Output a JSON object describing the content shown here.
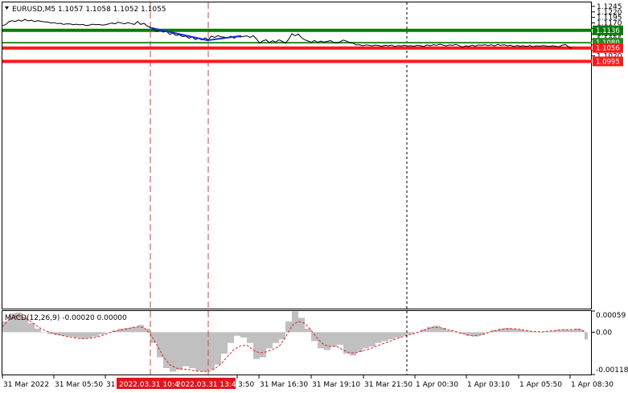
{
  "chart_data": {
    "type": "line",
    "symbol": "EURUSD,M5",
    "ohlc": {
      "open": "1.1057",
      "high": "1.1058",
      "low": "1.1052",
      "close": "1.1055"
    },
    "header_text": "EURUSD,M5  1.1057 1.1058 1.1052 1.1055",
    "price_axis": {
      "ylim": [
        0.9872,
        1.1263
      ],
      "ticks": [
        "1.1245",
        "1.1220",
        "1.1195",
        "1.1170",
        "1.1145",
        "1.1120",
        "1.1095",
        "1.1070",
        "1.1045",
        "1.1020"
      ]
    },
    "time_labels": [
      "31 Mar 2022",
      "31 Mar 05:50",
      "31",
      "3:50",
      "31 Mar 16:30",
      "31 Mar 19:10",
      "31 Mar 21:50",
      "1 Apr 00:30",
      "1 Apr 03:10",
      "1 Apr 05:50",
      "1 Apr 08:30"
    ],
    "highlighted_time_labels": [
      "2022.03.31 10:4",
      "2022.03.31 13:40"
    ],
    "levels": [
      {
        "value": 1.1136,
        "label": "1.1136",
        "color": "#0b7a0b",
        "style": "thick"
      },
      {
        "value": 1.108,
        "label": "1.1080",
        "color": "#1f8f1f",
        "style": "thin"
      },
      {
        "value": 1.1056,
        "label": "1.1056",
        "color": "#ff1a1a",
        "style": "thick"
      },
      {
        "value": 1.0995,
        "label": "1.0995",
        "color": "#ff1a1a",
        "style": "thick"
      }
    ],
    "price_series": {
      "name": "EURUSD",
      "color": "#000000",
      "x": [
        0,
        4,
        8,
        12,
        16,
        20,
        24,
        28,
        32,
        36,
        40,
        44,
        48,
        52,
        56,
        60,
        64,
        68,
        72,
        76,
        80,
        84,
        88,
        92,
        96,
        100,
        104,
        108,
        112,
        116,
        120,
        124,
        128,
        132,
        136,
        140,
        144,
        148,
        152,
        156,
        160,
        164,
        168,
        172,
        176,
        180,
        184,
        188,
        192,
        196,
        200,
        204,
        208,
        212,
        216,
        220,
        224,
        228,
        232,
        236,
        240,
        244,
        248,
        252,
        256,
        260,
        264,
        268,
        272,
        276,
        280,
        284,
        288,
        292,
        296,
        300,
        304,
        308,
        312,
        316,
        320,
        324,
        328,
        332,
        336,
        340,
        344,
        348,
        352,
        356,
        360,
        364,
        368,
        372,
        376,
        380,
        384,
        388,
        392,
        396,
        400,
        404,
        408,
        412,
        416,
        420,
        424,
        428,
        432,
        436,
        440,
        444,
        448,
        452,
        456,
        460,
        464,
        468,
        472,
        476,
        480,
        484,
        488,
        492,
        496,
        500,
        504,
        508,
        512,
        516,
        520,
        524,
        528,
        532,
        536,
        540,
        544,
        548,
        552,
        556,
        560,
        564,
        568,
        572,
        576,
        580,
        584,
        588,
        592,
        596,
        600,
        604,
        608,
        612,
        616,
        620,
        624,
        628,
        632,
        636,
        640,
        644,
        648,
        652,
        656,
        660,
        664,
        668,
        672,
        676,
        680,
        684,
        688,
        692,
        696,
        700,
        704,
        708,
        712,
        716,
        720,
        724
      ],
      "y": [
        1.1158,
        1.1162,
        1.1175,
        1.118,
        1.1176,
        1.1183,
        1.1178,
        1.1186,
        1.1179,
        1.1182,
        1.1176,
        1.118,
        1.1177,
        1.1175,
        1.1174,
        1.117,
        1.1171,
        1.1167,
        1.1168,
        1.1163,
        1.1166,
        1.1165,
        1.1162,
        1.1164,
        1.1161,
        1.1163,
        1.1158,
        1.116,
        1.1164,
        1.1162,
        1.1163,
        1.116,
        1.1162,
        1.1165,
        1.1169,
        1.1166,
        1.1173,
        1.1169,
        1.1166,
        1.1171,
        1.1167,
        1.1163,
        1.1176,
        1.1163,
        1.1168,
        1.1156,
        1.115,
        1.114,
        1.113,
        1.1138,
        1.1128,
        1.1132,
        1.1118,
        1.1123,
        1.1113,
        1.1116,
        1.1108,
        1.111,
        1.11,
        1.1106,
        1.1094,
        1.11,
        1.1092,
        1.1102,
        1.1094,
        1.111,
        1.1104,
        1.1112,
        1.1107,
        1.1105,
        1.1102,
        1.111,
        1.11,
        1.1108,
        1.1106,
        1.1109,
        1.1111,
        1.1104,
        1.1112,
        1.1097,
        1.1078,
        1.1089,
        1.1093,
        1.1081,
        1.1089,
        1.1083,
        1.1093,
        1.1086,
        1.1078,
        1.1095,
        1.1121,
        1.1112,
        1.1119,
        1.1103,
        1.1093,
        1.1088,
        1.1082,
        1.109,
        1.1082,
        1.1087,
        1.1083,
        1.1086,
        1.109,
        1.1081,
        1.1079,
        1.1084,
        1.1092,
        1.1087,
        1.1081,
        1.1078,
        1.107,
        1.1071,
        1.1066,
        1.107,
        1.1068,
        1.1066,
        1.1069,
        1.1067,
        1.1064,
        1.1068,
        1.1066,
        1.1069,
        1.1063,
        1.1067,
        1.1065,
        1.1068,
        1.1065,
        1.1066,
        1.1064,
        1.1068,
        1.1066,
        1.1063,
        1.107,
        1.1066,
        1.1071,
        1.1068,
        1.1073,
        1.1069,
        1.1066,
        1.107,
        1.1068,
        1.1072,
        1.1067,
        1.106,
        1.1066,
        1.1063,
        1.1069,
        1.1064,
        1.107,
        1.1068,
        1.1071,
        1.1067,
        1.1071,
        1.1065,
        1.1072,
        1.1068,
        1.1071,
        1.1066,
        1.1069,
        1.1063,
        1.1067,
        1.1064,
        1.1066,
        1.1063,
        1.1067,
        1.1062,
        1.1066,
        1.1064,
        1.1067,
        1.1065,
        1.1063,
        1.1066,
        1.1064,
        1.1061,
        1.1068,
        1.1072,
        1.1061,
        1.1055
      ]
    },
    "markup_lines": {
      "color": "#1a2fd6",
      "points": [
        [
          183,
          1.1149
        ],
        [
          255,
          1.1091
        ],
        [
          297,
          1.1111
        ]
      ]
    },
    "vlines": [
      {
        "x": 184,
        "color": "#e23b3b",
        "style": "dashed"
      },
      {
        "x": 256,
        "color": "#e23b3b",
        "style": "dashed"
      },
      {
        "x": 503,
        "color": "#000000",
        "style": "dotted"
      }
    ],
    "macd": {
      "label": "MACD(12,26,9) -0.00020 0.00000",
      "ylim": [
        -0.00118,
        0.00059
      ],
      "ticks": [
        "0.00059",
        "0.00",
        "-0.00118"
      ],
      "histogram_color": "#c0c0c0",
      "signal_color": "#e32222",
      "x": [
        0,
        8,
        16,
        24,
        32,
        40,
        48,
        56,
        64,
        72,
        80,
        88,
        96,
        104,
        112,
        120,
        128,
        136,
        144,
        152,
        160,
        168,
        176,
        184,
        192,
        200,
        208,
        216,
        224,
        232,
        240,
        248,
        256,
        264,
        272,
        280,
        288,
        296,
        304,
        312,
        320,
        328,
        336,
        344,
        352,
        360,
        368,
        376,
        384,
        392,
        400,
        408,
        416,
        424,
        432,
        440,
        448,
        456,
        464,
        472,
        480,
        488,
        496,
        504,
        512,
        520,
        528,
        536,
        544,
        552,
        560,
        568,
        576,
        584,
        592,
        600,
        608,
        616,
        624,
        632,
        640,
        648,
        656,
        664,
        672,
        680,
        688,
        696,
        704,
        712,
        720,
        724
      ],
      "histogram": [
        0.0003,
        0.00052,
        0.00055,
        0.0004,
        0.00025,
        0.0001,
        0.0,
        -5e-05,
        -8e-05,
        -0.0001,
        -0.00012,
        -0.00015,
        -0.00018,
        -0.00016,
        -0.00012,
        -6e-05,
        0.0,
        5e-05,
        0.0001,
        0.00012,
        0.00015,
        0.0002,
        0.0001,
        -0.0003,
        -0.0007,
        -0.001,
        -0.0011,
        -0.00105,
        -0.00095,
        -0.001,
        -0.00108,
        -0.0011,
        -0.00104,
        -0.0009,
        -0.0006,
        -0.0003,
        -0.0001,
        -0.00015,
        -0.0003,
        -0.00075,
        -0.0007,
        -0.00045,
        -0.0003,
        -0.0002,
        0.0003,
        0.00058,
        0.0004,
        0.0001,
        -0.00025,
        -0.00045,
        -0.0005,
        -0.0004,
        -0.00035,
        -0.0006,
        -0.00065,
        -0.00055,
        -0.00045,
        -0.0004,
        -0.0003,
        -0.00025,
        -0.0002,
        -0.00015,
        -0.0001,
        -5e-05,
        0.0,
        8e-05,
        0.00015,
        0.00018,
        0.00012,
        5e-05,
        0.0,
        -5e-05,
        -0.0001,
        -0.00012,
        -8e-05,
        0.0,
        6e-05,
        0.0001,
        0.00012,
        0.0001,
        8e-05,
        4e-05,
        2e-05,
        0.0,
        2e-05,
        4e-05,
        6e-05,
        8e-05,
        6e-05,
        0.0001,
        6e-05,
        -0.0002
      ],
      "signal": [
        0.00015,
        0.00035,
        0.00045,
        0.00043,
        0.00035,
        0.00022,
        0.0001,
        2e-05,
        -4e-05,
        -8e-05,
        -0.00012,
        -0.00015,
        -0.00018,
        -0.00018,
        -0.00016,
        -0.00012,
        -6e-05,
        0.0,
        5e-05,
        8e-05,
        0.00012,
        0.00015,
        0.00013,
        -5e-05,
        -0.00035,
        -0.00068,
        -0.0009,
        -0.001,
        -0.00103,
        -0.00104,
        -0.00108,
        -0.0011,
        -0.00109,
        -0.00102,
        -0.00088,
        -0.00068,
        -0.00048,
        -0.00038,
        -0.00036,
        -0.0005,
        -0.00058,
        -0.00055,
        -0.00048,
        -0.0004,
        -0.00015,
        0.00018,
        0.0003,
        0.00025,
        5e-05,
        -0.00018,
        -0.00035,
        -0.0004,
        -0.0004,
        -0.0005,
        -0.00058,
        -0.00057,
        -0.00052,
        -0.00047,
        -0.0004,
        -0.00033,
        -0.00027,
        -0.0002,
        -0.00014,
        -8e-05,
        -4e-05,
        2e-05,
        9e-05,
        0.00014,
        0.00013,
        8e-05,
        4e-05,
        -1e-05,
        -6e-05,
        -0.0001,
        -9e-05,
        -4e-05,
        2e-05,
        6e-05,
        9e-05,
        0.0001,
        9e-05,
        6e-05,
        3e-05,
        1e-05,
        1e-05,
        3e-05,
        5e-05,
        7e-05,
        7e-05,
        8e-05,
        7e-05,
        0.0
      ]
    }
  }
}
